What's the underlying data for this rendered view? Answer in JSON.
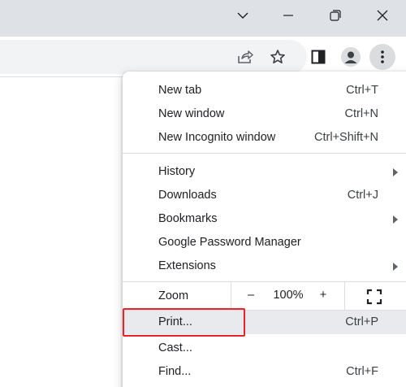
{
  "window": {
    "controls": [
      "chevron-down-icon",
      "minimize-icon",
      "restore-icon",
      "close-icon"
    ]
  },
  "toolbar": {
    "icons": [
      "share-icon",
      "bookmark-star-icon",
      "side-panel-icon",
      "profile-icon",
      "more-menu-icon"
    ]
  },
  "menu": {
    "group1": [
      {
        "label": "New tab",
        "shortcut": "Ctrl+T"
      },
      {
        "label": "New window",
        "shortcut": "Ctrl+N"
      },
      {
        "label": "New Incognito window",
        "shortcut": "Ctrl+Shift+N"
      }
    ],
    "group2": [
      {
        "label": "History",
        "shortcut": ""
      },
      {
        "label": "Downloads",
        "shortcut": "Ctrl+J"
      },
      {
        "label": "Bookmarks",
        "shortcut": ""
      },
      {
        "label": "Google Password Manager",
        "shortcut": ""
      },
      {
        "label": "Extensions",
        "shortcut": ""
      }
    ],
    "zoom": {
      "label": "Zoom",
      "minus": "–",
      "value": "100%",
      "plus": "+"
    },
    "group3": [
      {
        "label": "Print...",
        "shortcut": "Ctrl+P"
      },
      {
        "label": "Cast...",
        "shortcut": ""
      },
      {
        "label": "Find...",
        "shortcut": "Ctrl+F"
      }
    ]
  },
  "colors": {
    "titlebar": "#dee1e6",
    "highlight_box": "#e8232a",
    "hover": "#e8eaed"
  }
}
